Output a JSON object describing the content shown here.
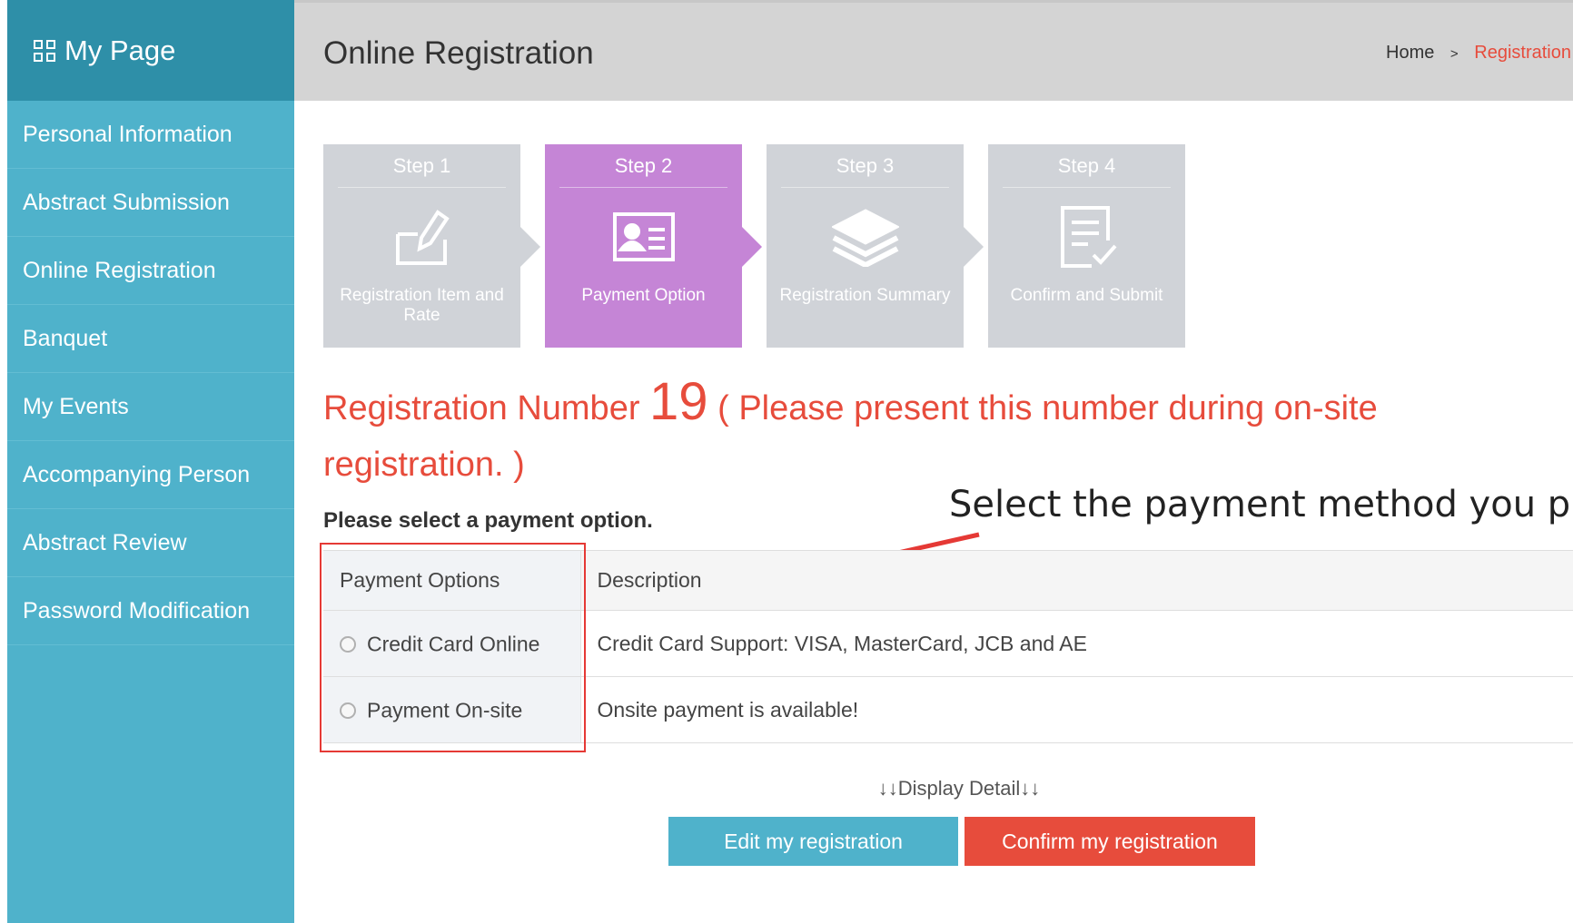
{
  "sidebar": {
    "title": "My Page",
    "items": [
      {
        "label": "Personal Information"
      },
      {
        "label": "Abstract Submission"
      },
      {
        "label": "Online Registration"
      },
      {
        "label": "Banquet"
      },
      {
        "label": "My Events"
      },
      {
        "label": "Accompanying Person"
      },
      {
        "label": "Abstract Review"
      },
      {
        "label": "Password Modification"
      }
    ]
  },
  "header": {
    "title": "Online Registration",
    "breadcrumb": {
      "home": "Home",
      "separator": ">",
      "current": "Registration"
    }
  },
  "steps": [
    {
      "title": "Step 1",
      "label": "Registration Item and Rate",
      "icon": "edit-icon",
      "active": false
    },
    {
      "title": "Step 2",
      "label": "Payment Option",
      "icon": "id-card-icon",
      "active": true
    },
    {
      "title": "Step 3",
      "label": "Registration Summary",
      "icon": "layers-icon",
      "active": false
    },
    {
      "title": "Step 4",
      "label": "Confirm and Submit",
      "icon": "checklist-icon",
      "active": false
    }
  ],
  "registration": {
    "prefix": "Registration Number",
    "number": "19",
    "note": "( Please present this number during on-site registration. )"
  },
  "payment": {
    "prompt": "Please select a payment option.",
    "annotation": "Select the payment method you pre",
    "headers": {
      "options": "Payment Options",
      "description": "Description"
    },
    "rows": [
      {
        "option": "Credit Card Online",
        "description": "Credit Card Support: VISA, MasterCard, JCB and AE"
      },
      {
        "option": "Payment On-site",
        "description": "Onsite payment is available!"
      }
    ]
  },
  "actions": {
    "display_detail": "↓↓Display Detail↓↓",
    "edit": "Edit my registration",
    "confirm": "Confirm my registration"
  },
  "colors": {
    "sidebar": "#4fb2cb",
    "sidebar_header": "#2e8fa8",
    "active_step": "#c585d6",
    "inactive_step": "#d0d3d8",
    "accent_red": "#e74c3c",
    "highlight_box": "#e53935"
  }
}
